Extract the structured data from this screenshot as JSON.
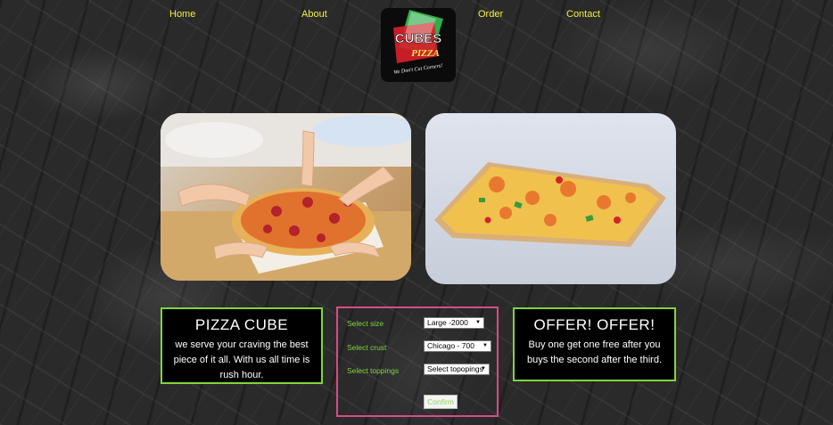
{
  "nav": {
    "home": "Home",
    "about": "About",
    "order": "Order",
    "contact": "Contact"
  },
  "logo": {
    "brand": "CUBES",
    "sub": "PIZZA",
    "tagline": "We Don't Cut Corners!"
  },
  "about_card": {
    "title": "PIZZA CUBE",
    "text": "we serve your craving the best piece of it all. With us all time is rush hour."
  },
  "order_form": {
    "size_label": "Select size",
    "size_value": "Large -2000",
    "crust_label": "Select crust",
    "crust_value": "Chicago - 700",
    "toppings_label": "Select toppings",
    "toppings_value": "Select topopings",
    "confirm_label": "Confirm"
  },
  "offer_card": {
    "title": "OFFER! OFFER!",
    "text": "Buy one get one free after you buys the second after the third."
  },
  "colors": {
    "nav_text": "#f0f03c",
    "card_border": "#7fd63a",
    "form_border": "#d94b86",
    "form_label": "#7fd63a"
  }
}
